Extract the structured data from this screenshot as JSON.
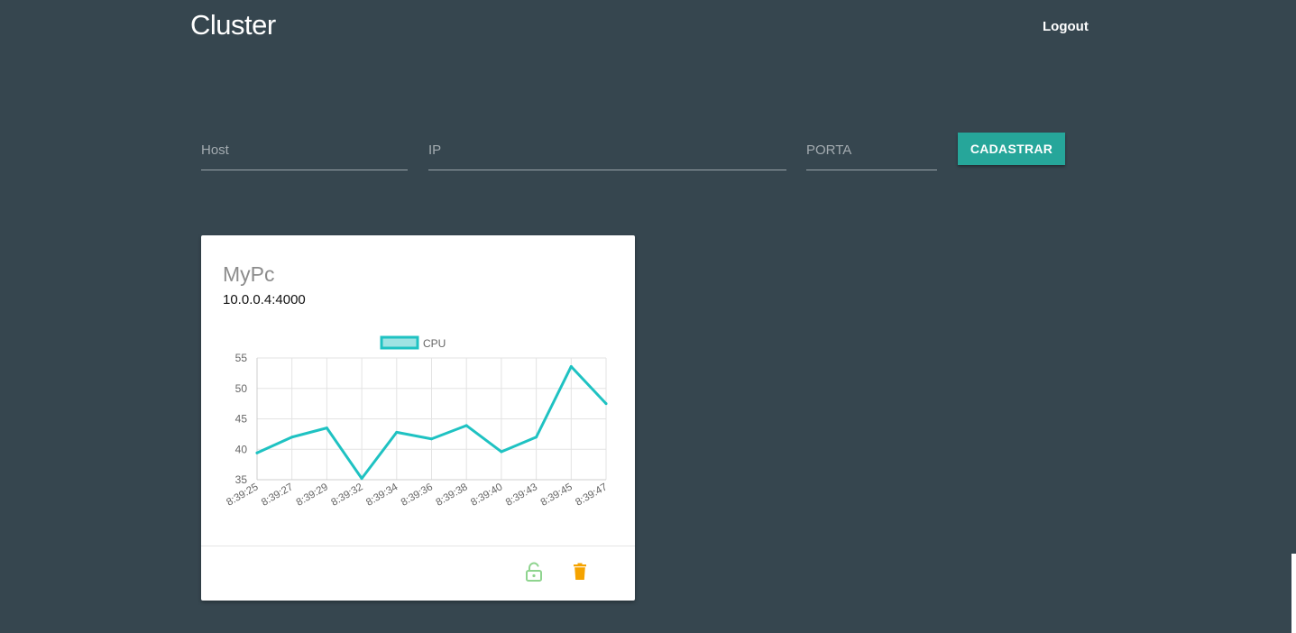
{
  "app": {
    "brand": "Cluster",
    "logout_label": "Logout"
  },
  "form": {
    "host_placeholder": "Host",
    "ip_placeholder": "IP",
    "port_placeholder": "PORTA",
    "host_value": "",
    "ip_value": "",
    "port_value": "",
    "register_label": "CADASTRAR"
  },
  "colors": {
    "background": "#36464f",
    "accent": "#26a69a",
    "chart_line": "#1fc2c2",
    "lock_icon": "#8fd48f",
    "trash_icon": "#f5a300"
  },
  "card": {
    "title": "MyPc",
    "address": "10.0.0.4:4000",
    "actions": {
      "lock_icon": "lock-open-icon",
      "trash_icon": "trash-icon"
    }
  },
  "chart_data": {
    "type": "line",
    "title": "",
    "xlabel": "",
    "ylabel": "",
    "legend_position": "top",
    "grid": true,
    "ylim": [
      35,
      55
    ],
    "yticks": [
      "35",
      "40",
      "45",
      "50",
      "55"
    ],
    "categories": [
      "8:39:25",
      "8:39:27",
      "8:39:29",
      "8:39:32",
      "8:39:34",
      "8:39:36",
      "8:39:38",
      "8:39:40",
      "8:39:43",
      "8:39:45",
      "8:39:47"
    ],
    "series": [
      {
        "name": "CPU",
        "values": [
          39.4,
          42.0,
          43.5,
          35.2,
          42.8,
          41.7,
          43.9,
          39.6,
          42.0,
          53.6,
          47.5
        ]
      }
    ]
  }
}
